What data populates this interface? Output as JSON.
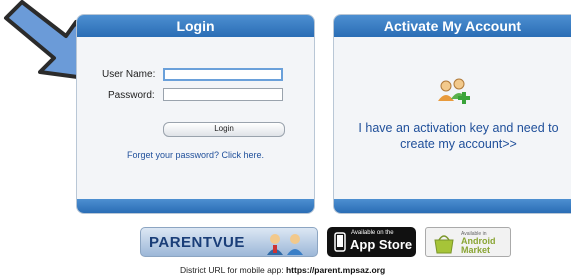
{
  "login": {
    "title": "Login",
    "username_label": "User Name:",
    "username_value": "",
    "password_label": "Password:",
    "password_value": "",
    "login_button": "Login",
    "forgot_link": "Forget your password? Click here."
  },
  "activate": {
    "title": "Activate My Account",
    "message": "I have an activation key and need to create my account>>",
    "icon": "users-add-icon"
  },
  "badges": {
    "parentvue": "PARENTVUE",
    "appstore_small": "Available on the",
    "appstore_big": "App Store",
    "android_small": "Available in",
    "android_big_1": "Android",
    "android_big_2": "Market"
  },
  "district": {
    "label": "District URL for mobile app:",
    "url": "https://parent.mpsaz.org"
  },
  "colors": {
    "header_blue": "#2a6db5",
    "link_blue": "#1f4f9a",
    "arrow_blue": "#6b9bd8"
  }
}
